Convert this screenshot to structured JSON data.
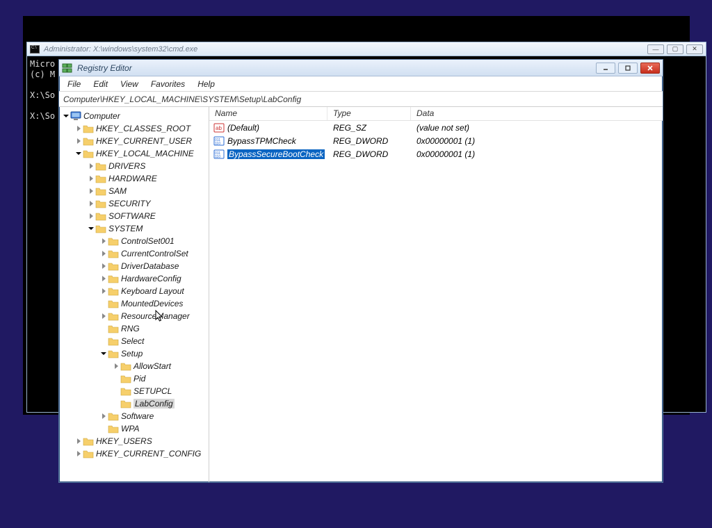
{
  "cmd": {
    "title": "Administrator: X:\\windows\\system32\\cmd.exe",
    "line1": "Micro",
    "line2": "(c) M",
    "line3": "",
    "line4": "X:\\So",
    "line5": "",
    "line6": "X:\\So"
  },
  "regedit": {
    "title": "Registry Editor",
    "address": "Computer\\HKEY_LOCAL_MACHINE\\SYSTEM\\Setup\\LabConfig"
  },
  "menu": {
    "file": "File",
    "edit": "Edit",
    "view": "View",
    "favorites": "Favorites",
    "help": "Help"
  },
  "cols": {
    "name": "Name",
    "type": "Type",
    "data": "Data"
  },
  "tree": {
    "computer": "Computer",
    "hkcr": "HKEY_CLASSES_ROOT",
    "hkcu": "HKEY_CURRENT_USER",
    "hklm": "HKEY_LOCAL_MACHINE",
    "drivers": "DRIVERS",
    "hardware": "HARDWARE",
    "sam": "SAM",
    "security": "SECURITY",
    "software_caps": "SOFTWARE",
    "system": "SYSTEM",
    "cs001": "ControlSet001",
    "ccs": "CurrentControlSet",
    "drvdb": "DriverDatabase",
    "hwcfg": "HardwareConfig",
    "kbl": "Keyboard Layout",
    "mdev": "MountedDevices",
    "resmgr": "ResourceManager",
    "rng": "RNG",
    "select": "Select",
    "setup": "Setup",
    "allowstart": "AllowStart",
    "pid": "Pid",
    "setupcl": "SETUPCL",
    "labconfig": "LabConfig",
    "software": "Software",
    "wpa": "WPA",
    "hku": "HKEY_USERS",
    "hkcc": "HKEY_CURRENT_CONFIG"
  },
  "values": {
    "default": {
      "name": "(Default)",
      "type": "REG_SZ",
      "data": "(value not set)"
    },
    "tpm": {
      "name": "BypassTPMCheck",
      "type": "REG_DWORD",
      "data": "0x00000001 (1)"
    },
    "sb": {
      "name": "BypassSecureBootCheck",
      "type": "REG_DWORD",
      "data": "0x00000001 (1)"
    }
  }
}
